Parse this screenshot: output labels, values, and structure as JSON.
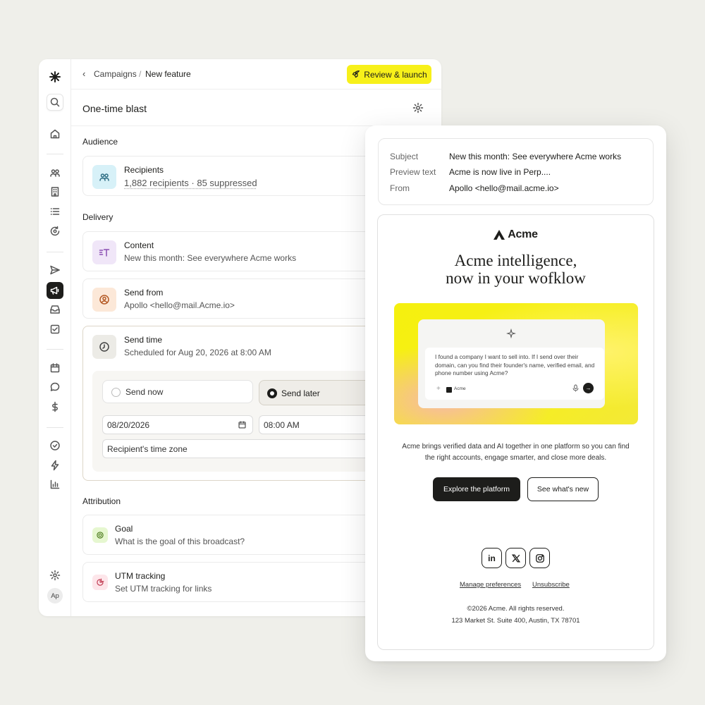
{
  "breadcrumb": {
    "parent": "Campaigns",
    "separator": "/",
    "current": "New feature"
  },
  "launch_button": "Review & launch",
  "campaign_title": "One-time blast",
  "sidebar": {
    "avatar": "Ap"
  },
  "sections": {
    "audience": "Audience",
    "delivery": "Delivery",
    "attribution": "Attribution"
  },
  "recipients": {
    "label": "Recipients",
    "value": "1,882 recipients · 85 suppressed"
  },
  "content": {
    "label": "Content",
    "value": "New this month: See everywhere Acme works"
  },
  "send_from": {
    "label": "Send from",
    "value": "Apollo <hello@mail.Acme.io>"
  },
  "send_time": {
    "label": "Send time",
    "value": "Scheduled for Aug 20, 2026 at 8:00 AM",
    "send_now": "Send now",
    "send_later": "Send later",
    "selected": "Send later",
    "date": "08/20/2026",
    "time": "08:00 AM",
    "timezone": "Recipient's time zone"
  },
  "goal": {
    "label": "Goal",
    "placeholder": "What is the goal of this broadcast?"
  },
  "utm": {
    "label": "UTM tracking",
    "value": "Set UTM tracking for links"
  },
  "email": {
    "subject_label": "Subject",
    "subject": "New this month: See everywhere Acme works",
    "preview_label": "Preview text",
    "preview": "Acme is now live in Perp....",
    "from_label": "From",
    "from": "Apollo <hello@mail.acme.io>",
    "brand": "Acme",
    "headline_1": "Acme intelligence,",
    "headline_2": "now in your wofklow",
    "prompt_text": "I found a company I want to sell into. If I send over their domain, can you find their founder's name, verified email, and phone number using Acme?",
    "prompt_chip": "Acme",
    "body_line_1": "Acme brings verified data and AI together in one platform so you can find",
    "body_line_2": "the right accounts, engage smarter, and close more deals.",
    "cta_primary": "Explore the platform",
    "cta_secondary": "See what's new",
    "manage": "Manage preferences",
    "unsubscribe": "Unsubscribe",
    "copyright": "©2026 Acme. All rights reserved.",
    "address": "123 Market St. Suite 400, Austin, TX 78701"
  },
  "colors": {
    "accent_yellow": "#F7F01A",
    "dark": "#1d1d1b",
    "bg": "#EFEFEA"
  }
}
